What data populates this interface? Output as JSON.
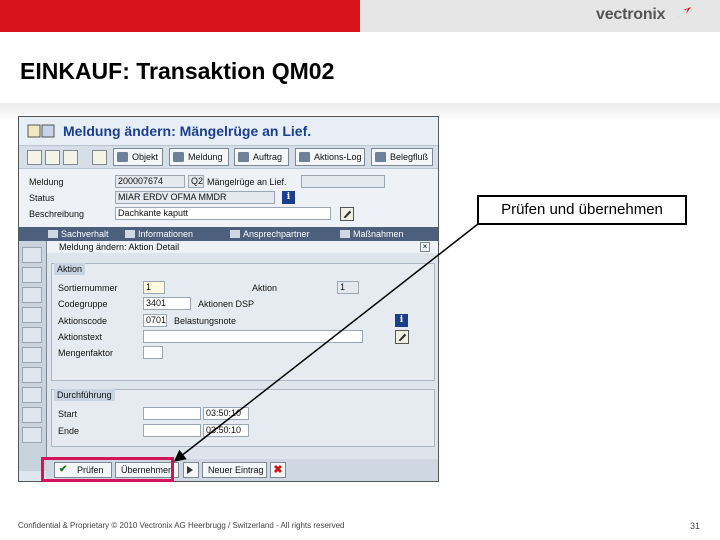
{
  "header": {
    "brand": "vectronix",
    "colors": {
      "red": "#d9131b",
      "grey": "#e6e6e6"
    }
  },
  "slide": {
    "title": "EINKAUF: Transaktion QM02"
  },
  "sap": {
    "window_title": "Meldung ändern: Mängelrüge an Lief.",
    "toolbar": {
      "buttons": [
        "Objekt",
        "Meldung",
        "Auftrag",
        "Aktions-Log",
        "Belegfluß"
      ]
    },
    "header_fields": {
      "meldung_label": "Meldung",
      "meldung_value": "200007674",
      "meldung_type": "Q2",
      "meldung_text": "Mängelrüge an Lief.",
      "status_label": "Status",
      "status_value": "MIAR ERDV OFMA MMDR",
      "beschreibung_label": "Beschreibung",
      "beschreibung_value": "Dachkante kaputt"
    },
    "tabs": [
      "Sachverhalt",
      "Informationen",
      "Ansprechpartner",
      "Maßnahmen"
    ],
    "dialog": {
      "title": "Meldung ändern: Aktion Detail",
      "aktion_group": {
        "title": "Aktion",
        "sortiernummer_label": "Sortiernummer",
        "sortiernummer_value": "1",
        "aktion_label": "Aktion",
        "aktion_value": "1",
        "codegruppe_label": "Codegruppe",
        "codegruppe_value": "3401",
        "codegruppe_text": "Aktionen DSP",
        "aktionscode_label": "Aktionscode",
        "aktionscode_value": "0701",
        "aktionscode_text": "Belastungsnote",
        "aktionstext_label": "Aktionstext",
        "aktionstext_value": "",
        "mengenfaktor_label": "Mengenfaktor",
        "mengenfaktor_value": ""
      },
      "durchfuehrung_group": {
        "title": "Durchführung",
        "start_label": "Start",
        "start_value": "",
        "start_time": "03:50:10",
        "ende_label": "Ende",
        "ende_value": "",
        "ende_time": "03:50:10"
      },
      "buttons": {
        "pruefen": "Prüfen",
        "uebernehmen": "Übernehmen",
        "neuer_eintrag": "Neuer Eintrag"
      }
    }
  },
  "callout": {
    "text": "Prüfen und übernehmen",
    "highlight_color": "#d4145a"
  },
  "footer": {
    "text": "Confidential & Proprietary © 2010 Vectronix AG Heerbrugg / Switzerland - All rights reserved",
    "page": "31"
  }
}
